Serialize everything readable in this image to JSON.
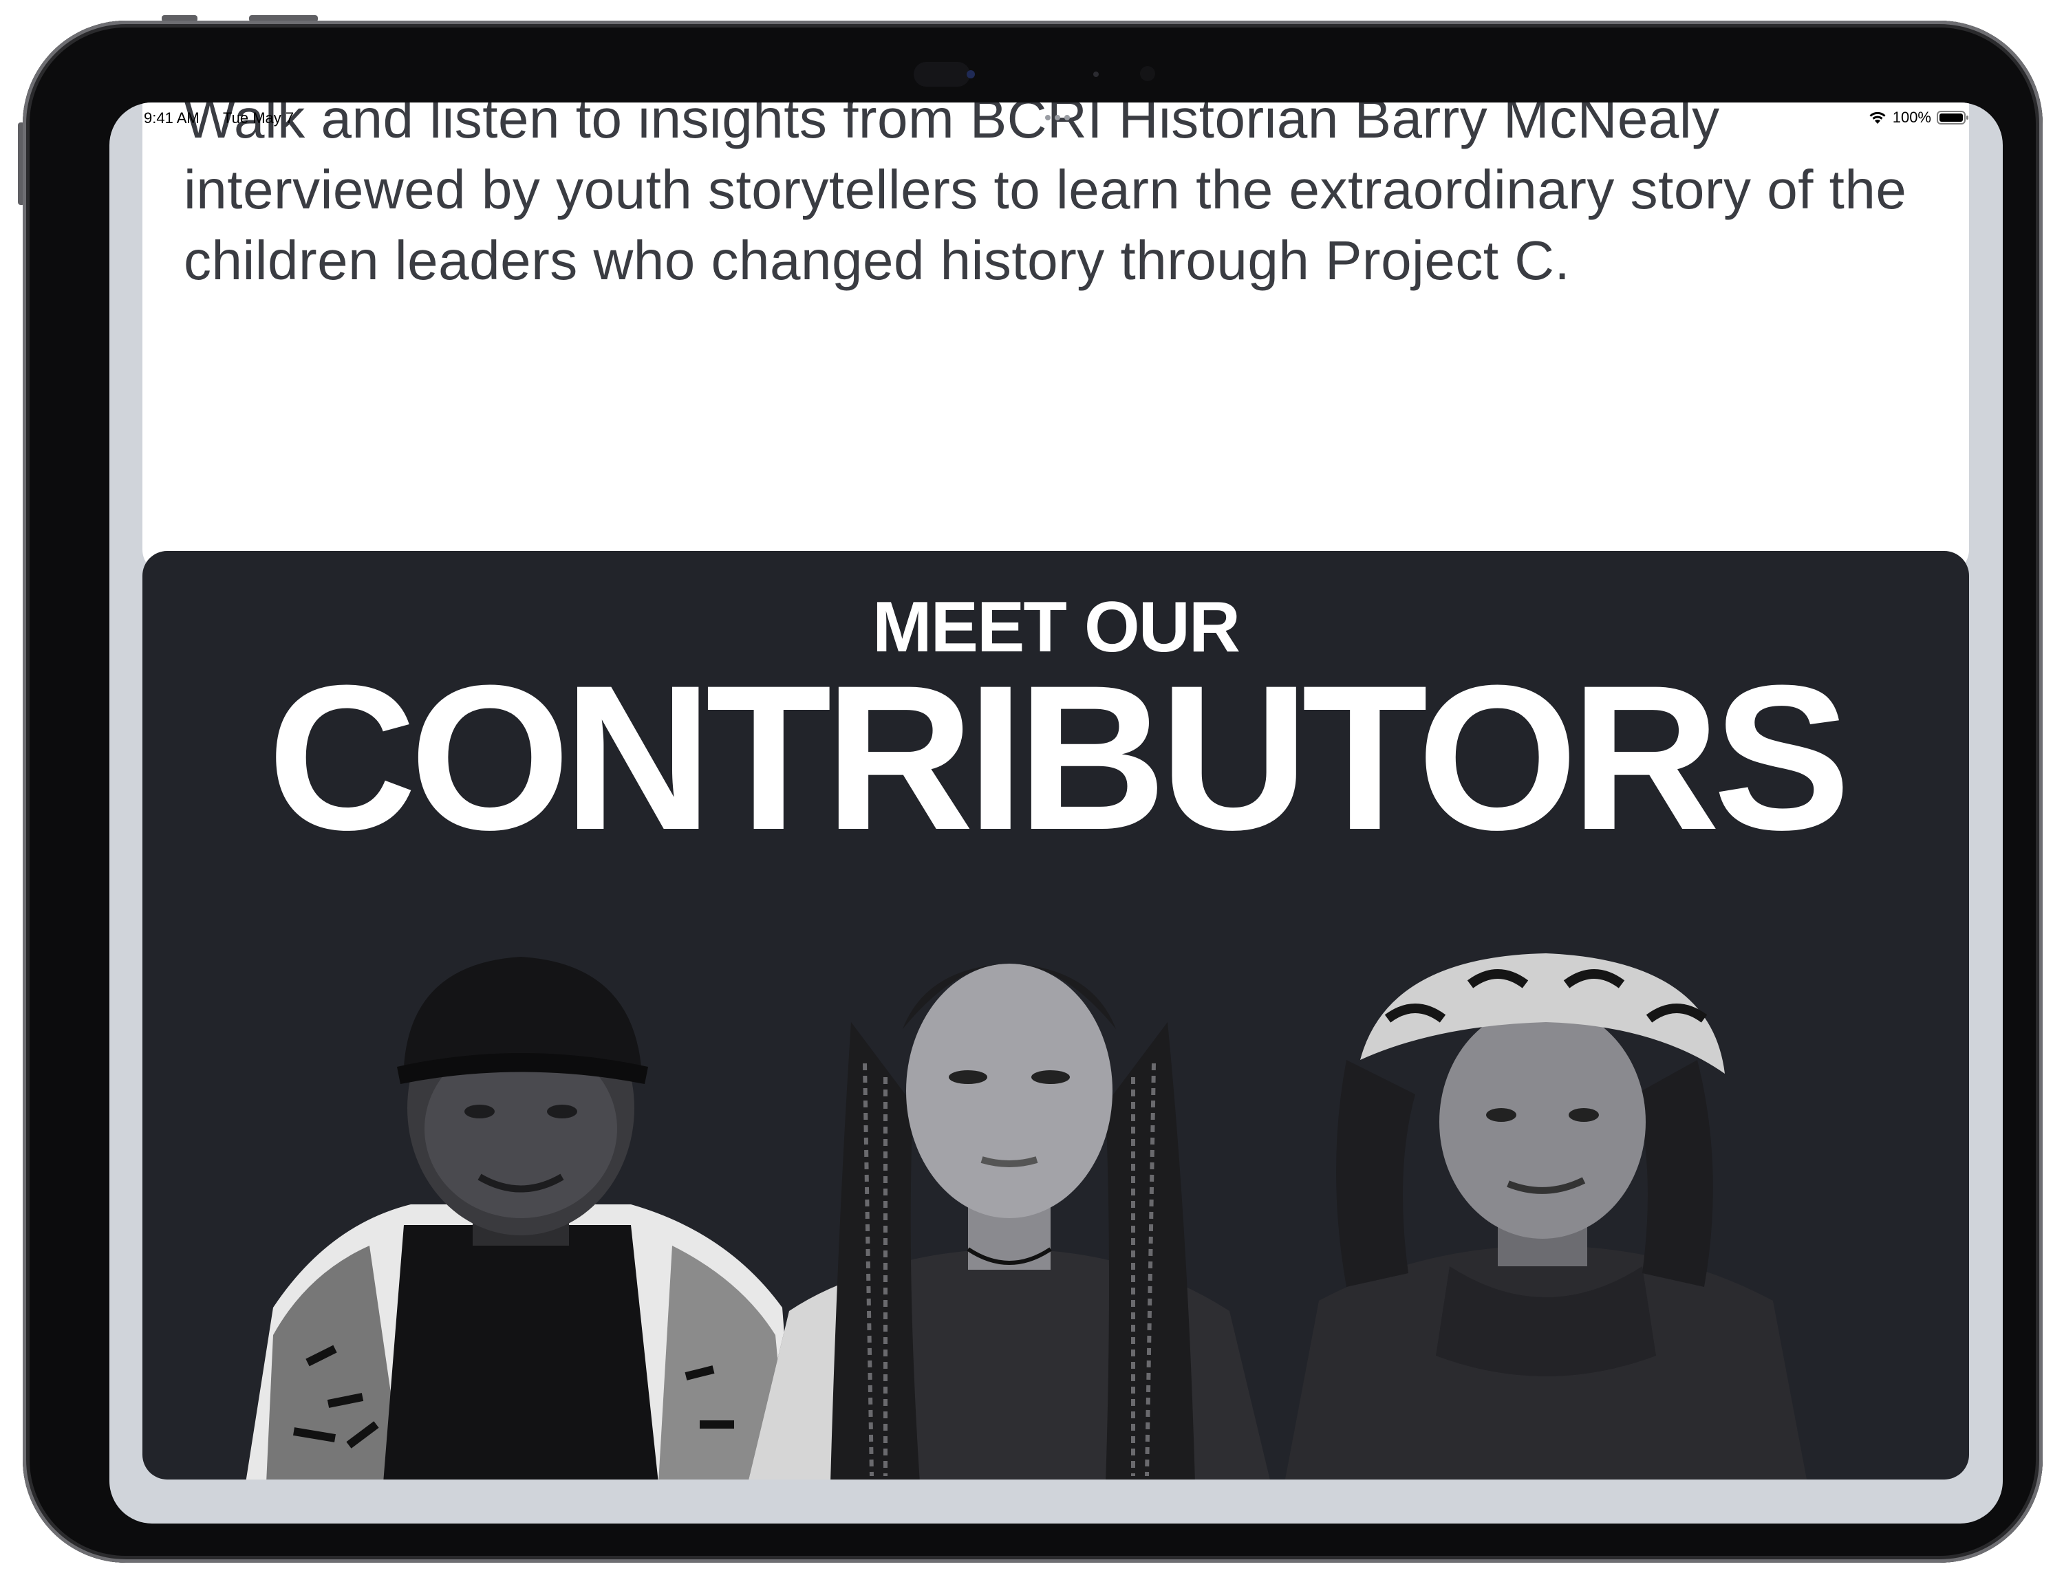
{
  "status_bar": {
    "time": "9:41 AM",
    "date": "Tue May 7",
    "battery": "100%"
  },
  "intro": {
    "text": "Walk and listen to insights from BCRI Historian Barry McNealy interviewed by youth storytellers to learn the extraordinary story of the children leaders who changed history through Project C."
  },
  "contributors": {
    "kicker": "MEET OUR",
    "title": "CONTRIBUTORS"
  },
  "colors": {
    "screen_bg": "#d0d4da",
    "card_dark": "#22242a",
    "card_light": "#ffffff",
    "heading": "#ffffff",
    "body_text": "#3a3c42"
  }
}
